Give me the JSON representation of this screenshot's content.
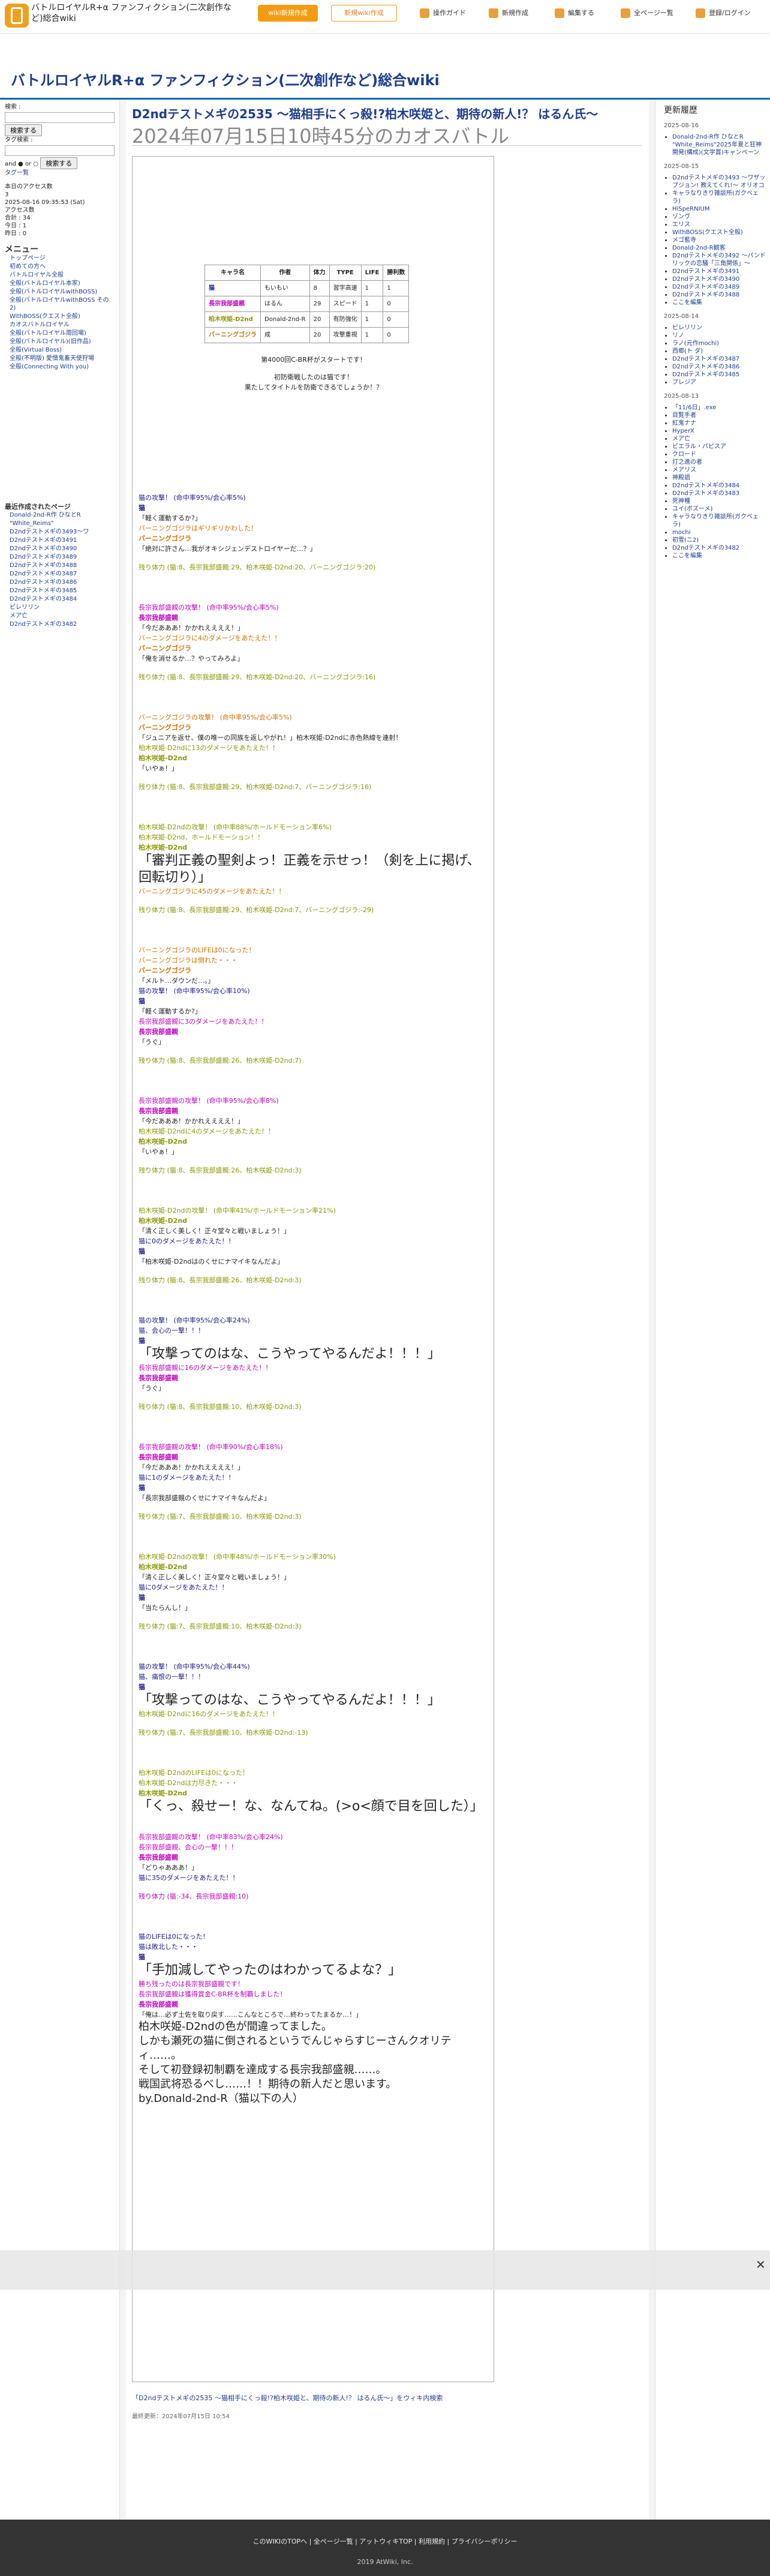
{
  "site": {
    "name": "バトルロイヤルR+α ファンフィクション(二次創作など)総合wiki",
    "wiki_btn": "wiki新規作成",
    "anno_btn": "新規wiki作成",
    "tools": [
      "操作ガイド",
      "新規作成",
      "編集する",
      "全ページ一覧",
      "登録/ログイン"
    ]
  },
  "left": {
    "search_label": "検索 :",
    "search_btn": "検索する",
    "tag_label": "タグ検索 :",
    "and_or": "and ● or ○",
    "tag_btn": "検索する",
    "tag_help": "タグ一覧",
    "count_title": "本日のアクセス数",
    "count_value": "3",
    "date": "2025-08-16 09:35:53 (Sat)",
    "access": "アクセス数",
    "total": "合計 : 34",
    "today": "今日 : 1",
    "yesterday": "昨日 : 0",
    "menu_title": "メニュー",
    "menu": [
      "トップページ",
      "初めての方へ",
      "バトルロイヤル全般",
      "全般(バトルロイヤル本家)",
      "全般(バトルロイヤルwithBOSS)",
      "全般(バトルロイヤルwithBOSS その2)",
      "WithBOSS(クエスト全般)",
      "カオスバトルロイヤル",
      "全般(バトルロイヤル周回場)",
      "全般(バトルロイヤル)(旧作品)",
      "全般(Virtual Boss)",
      "全般(不明版) 愛憎鬼畜天使狩場",
      "全般(Connecting With you)"
    ],
    "recent_title": "最近作成されたページ",
    "recent": [
      "Donald-2nd-R作 ひなとR",
      "\"White_Reims\"",
      "D2ndテストメギの3493〜ワ",
      "D2ndテストメギの3491",
      "D2ndテストメギの3490",
      "D2ndテストメギの3489",
      "D2ndテストメギの3488",
      "D2ndテストメギの3487",
      "D2ndテストメギの3486",
      "D2ndテストメギの3485",
      "D2ndテストメギの3484",
      "ビレリリン",
      "メア亡",
      "D2ndテストメギの3482"
    ]
  },
  "right": {
    "title": "更新履歴",
    "dates": [
      "2025-08-16",
      "2025-08-15",
      "2025-08-14",
      "2025-08-13"
    ],
    "d1": [
      "Donald-2nd-R作 ひなとR \"White_Reims\"2025年夏と狂神開発(構成)(文学賞)キャンペーン"
    ],
    "d2": [
      "D2ndテストメギの3493 〜ワザップジョン! 教えてくれ!〜 オリオコ",
      "キャラなりきり雑談所(ガクベェラ)",
      "HiSpeRNIUM",
      "ゾンヴ",
      "エリス",
      "WithBOSS(クエスト全般)",
      "メゴ藍寺",
      "Donald-2nd-R観客",
      "D2ndテストメギの3492 〜パンドリックの恋騒「三角関係」〜",
      "D2ndテストメギの3491",
      "D2ndテストメギの3490",
      "D2ndテストメギの3489",
      "D2ndテストメギの3488",
      "ここを編集"
    ],
    "d3": [
      "ビレリリン",
      "リノ",
      "ラノ(元作mochi)",
      "西郷(ト ダ)",
      "D2ndテストメギの3487",
      "D2ndテストメギの3486",
      "D2ndテストメギの3485",
      "プレジア"
    ],
    "d4": [
      "「11/6日」.exe",
      "目覧手者",
      "紅鬼ナナ",
      "HyperX",
      "メア亡",
      "ビエラル・パピスア",
      "クロード",
      "灯之進の者",
      "メアリス",
      "神殿語",
      "D2ndテストメギの3484",
      "D2ndテストメギの3483",
      "死神種",
      "ユイ(ボズーメ)",
      "キャラなりきり雑談所(ガクベェラ)",
      "mochi",
      "初雪(ニ2)",
      "D2ndテストメギの3482",
      "ここを編集"
    ]
  },
  "article": {
    "title": "D2ndテストメギの2535 〜猫相手にくっ殺!?柏木咲姫と、期待の新人!？ はるん氏〜",
    "subtitle": "2024年07月15日10時45分のカオスバトル",
    "table_head": [
      "キャラ名",
      "作者",
      "体力",
      "TYPE",
      "LIFE",
      "勝利数"
    ],
    "rows": [
      [
        "猫",
        "もいもい",
        "8",
        "習字高速",
        "1",
        "1"
      ],
      [
        "長宗我部盛親",
        "はるん",
        "29",
        "スピード",
        "1",
        "0"
      ],
      [
        "柏木咲姫-D2nd",
        "Donald-2nd-R",
        "20",
        "有防強化",
        "1",
        "0"
      ],
      [
        "バーニングゴジラ",
        "成",
        "20",
        "攻撃重視",
        "1",
        "0"
      ]
    ],
    "intro": [
      "第4000回C-BR杯がスタートです！",
      "初防衛戦したのは猫です！",
      "果たしてタイトルを防衛できるでしょうか！？"
    ],
    "lines": [
      "猫の攻撃！ (命中率95%/会心率5%)",
      "猫",
      "「軽く運動するか?」",
      "バーニングゴジラはギリギリかわした！",
      "バーニングゴジラ",
      "「絶対に許さん…我がオキシジェンデストロイヤーだ…？」",
      "残り体力 (猫:8、長宗我部盛親:29、柏木咲姫-D2nd:20、バーニングゴジラ:20)",
      "長宗我部盛親の攻撃！ (命中率95%/会心率5%)",
      "長宗我部盛親",
      "「今だあああ！かかれええええ！」",
      "バーニングゴジラに4のダメージをあたえた！！",
      "バーニングゴジラ",
      "「俺を消せるか…？やってみろよ」",
      "残り体力 (猫:8、長宗我部盛親:29、柏木咲姫-D2nd:20、バーニングゴジラ:16)",
      "バーニングゴジラの攻撃！ (命中率95%/会心率5%)",
      "バーニングゴジラ",
      "「ジュニアを返せ、僕の唯一の同族を返しやがれ！」柏木咲姫-D2ndに赤色熱線を連射！",
      "柏木咲姫-D2ndに13のダメージをあたえた！！",
      "柏木咲姫-D2nd",
      "「いやぁ！」",
      "残り体力 (猫:8、長宗我部盛親:29、柏木咲姫-D2nd:7、バーニングゴジラ:16)",
      "柏木咲姫-D2ndの攻撃！ (命中率88%/ホールドモーション率6%)",
      "柏木咲姫-D2nd、ホールドモーション！！",
      "柏木咲姫-D2nd",
      "「審判正義の聖剣よっ！正義を示せっ！（剣を上に掲げ、回転切り）」",
      "バーニングゴジラに45のダメージをあたえた！！",
      "残り体力 (猫:8、長宗我部盛親:29、柏木咲姫-D2nd:7、バーニングゴジラ:-29)",
      "バーニングゴジラのLIFEは0になった！",
      "バーニングゴジラは倒れた・・・",
      "バーニングゴジラ",
      "「メルト…ダウンだ…。」",
      "猫の攻撃！ (命中率95%/会心率10%)",
      "猫",
      "「軽く運動するか?」",
      "長宗我部盛親に3のダメージをあたえた！！",
      "長宗我部盛親",
      "「うぐ」",
      "残り体力 (猫:8、長宗我部盛親:26、柏木咲姫-D2nd:7)",
      "長宗我部盛親の攻撃！ (命中率95%/会心率8%)",
      "長宗我部盛親",
      "「今だあああ！かかれええええ！」",
      "柏木咲姫-D2ndに4のダメージをあたえた！！",
      "柏木咲姫-D2nd",
      "「いやぁ！」",
      "残り体力 (猫:8、長宗我部盛親:26、柏木咲姫-D2nd:3)",
      "柏木咲姫-D2ndの攻撃！ (命中率41%/ホールドモーション率21%)",
      "柏木咲姫-D2nd",
      "「清く正しく美しく！正々堂々と戦いましょう！」",
      "猫に0のダメージをあたえた！！",
      "猫",
      "「柏木咲姫-D2ndはのくせにナマイキなんだよ」",
      "残り体力 (猫:8、長宗我部盛親:26、柏木咲姫-D2nd:3)",
      "猫の攻撃！ (命中率95%/会心率24%)",
      "猫、会心の一撃！！！",
      "猫",
      "「攻撃ってのはな、こうやってやるんだよ！！！」",
      "長宗我部盛親に16のダメージをあたえた！！",
      "長宗我部盛親",
      "「うぐ」",
      "残り体力 (猫:8、長宗我部盛親:10、柏木咲姫-D2nd:3)",
      "長宗我部盛親の攻撃！ (命中率90%/会心率18%)",
      "長宗我部盛親",
      "「今だあああ！かかれええええ！」",
      "猫に1のダメージをあたえた！！",
      "猫",
      "「長宗我部盛親のくせにナマイキなんだよ」",
      "残り体力 (猫:7、長宗我部盛親:10、柏木咲姫-D2nd:3)",
      "柏木咲姫-D2ndの攻撃！ (命中率48%/ホールドモーション率30%)",
      "柏木咲姫-D2nd",
      "「清く正しく美しく！正々堂々と戦いましょう！」",
      "猫に0ダメージをあたえた！！",
      "猫",
      "「当たらんし！」",
      "残り体力 (猫:7、長宗我部盛親:10、柏木咲姫-D2nd:3)",
      "猫の攻撃！ (命中率95%/会心率44%)",
      "猫、痛恨の一撃！！！",
      "猫",
      "「攻撃ってのはな、こうやってやるんだよ！！！」",
      "柏木咲姫-D2ndに16のダメージをあたえた！！",
      "残り体力 (猫:7、長宗我部盛親:10、柏木咲姫-D2nd:-13)",
      "柏木咲姫-D2ndのLIFEは0になった！",
      "柏木咲姫-D2ndは力尽きた・・・",
      "柏木咲姫-D2nd",
      "「くっ、殺せー！な、なんてね。(>o<顔で目を回した）」",
      "長宗我部盛親の攻撃！ (命中率83%/会心率24%)",
      "長宗我部盛親、会心の一撃！！！",
      "長宗我部盛親",
      "「どりゃあああ！」",
      "猫に35のダメージをあたえた！！",
      "残り体力 (猫:-34、長宗我部盛親:10)",
      "猫のLIFEは0になった！",
      "猫は敗北した・・・",
      "猫",
      "「手加減してやったのはわかってるよな？」",
      "勝ち残ったのは長宗我部盛親です！",
      "長宗我部盛親は獲得賞金C-BR杯を制覇しました！",
      "長宗我部盛親",
      "「俺は…必ず土佐を取り戻す……こんなところで…終わってたまるか…！」",
      "柏木咲姫-D2ndの色が間違ってました。",
      "しかも瀬死の猫に倒されるというでんじゃらすじーさんクオリティ……。",
      "そして初登録初制覇を達成する長宗我部盛親……。",
      "戦国武将恐るべし……！！期待の新人だと思います。",
      "by.Donald-2nd-R（猫以下の人）"
    ],
    "edit_link": "「D2ndテストメギの2535 〜猫相手にくっ殺!?柏木咲姫と、期待の新人!？ はるん氏〜」をウィキ内検索",
    "updated": "最終更新：2024年07月15日 10:54"
  },
  "footer": {
    "links": "このWIKIのTOPへ  |  全ページ一覧  |  アットウィキTOP  |  利用規約  |  プライバシーポリシー",
    "copy": "2019 AtWiki, Inc."
  }
}
